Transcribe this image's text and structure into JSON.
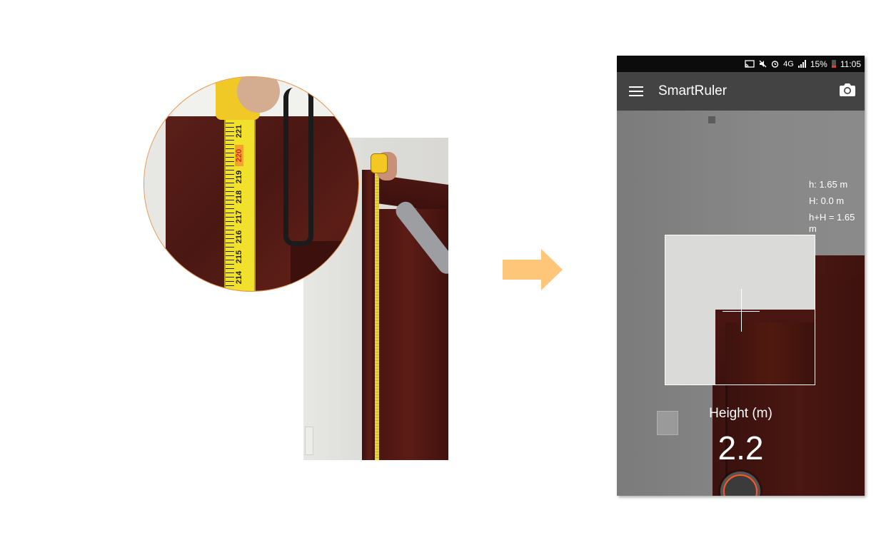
{
  "left_photo": {
    "tape_numbers": [
      "221",
      "220",
      "219",
      "218",
      "217",
      "216",
      "215",
      "214"
    ]
  },
  "arrow": {
    "color": "#fdc679"
  },
  "phone": {
    "status_bar": {
      "network": "4G",
      "battery_percent": "15%",
      "time": "11:05",
      "icons": [
        "cast-icon",
        "mute-icon",
        "alarm-icon",
        "signal-icon",
        "battery-icon"
      ]
    },
    "app_bar": {
      "title": "SmartRuler",
      "menu_icon": "hamburger-menu-icon",
      "camera_icon": "camera-icon"
    },
    "readout": {
      "h": "h: 1.65 m",
      "H": "H: 0.0 m",
      "sum": "h+H = 1.65 m"
    },
    "measurement": {
      "label": "Height (m)",
      "value": "2.2"
    },
    "colors": {
      "app_bar": "#434343",
      "status_bar": "#0c0c0c",
      "shutter_accent": "#ff5722"
    }
  }
}
